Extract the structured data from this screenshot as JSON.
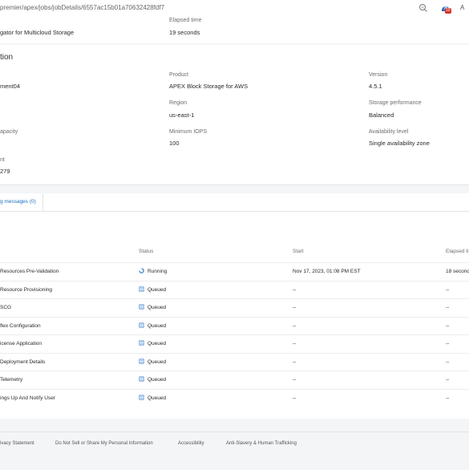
{
  "browser": {
    "url": "premier/apex/jobs/jobDetails/6557ac15b01a70632428fdf7",
    "extension_badge": "10",
    "profile_initial": "A"
  },
  "summary": {
    "name_value": "gator for Multicloud Storage",
    "elapsed_label": "Elapsed time",
    "elapsed_value": "19 seconds"
  },
  "details": {
    "heading": "tion",
    "fields": {
      "deployment_value": "ment04",
      "product_label": "Product",
      "product_value": "APEX Block Storage for AWS",
      "version_label": "Version",
      "version_value": "4.5.1",
      "region_label": "Region",
      "region_value": "us-east-1",
      "perf_label": "Storage performance",
      "perf_value": "Balanced",
      "capacity_label": "apacity",
      "iops_label": "Minimum IOPS",
      "iops_value": "100",
      "avail_label": "Availability level",
      "avail_value": "Single availability zone",
      "account_label": "nt",
      "account_value": "279"
    }
  },
  "tabs": {
    "messages": "g messages (0)"
  },
  "table": {
    "headers": {
      "status": "Status",
      "start": "Start",
      "elapsed": "Elapsed ti"
    },
    "rows": [
      {
        "task": "Resources Pre-Validation",
        "status": "Running",
        "start": "Nov 17, 2023, 01:08 PM EST",
        "elapsed": "18 second"
      },
      {
        "task": "Resource Provisioning",
        "status": "Queued",
        "start": "--",
        "elapsed": "--"
      },
      {
        "task": "SCG",
        "status": "Queued",
        "start": "--",
        "elapsed": "--"
      },
      {
        "task": "flex Configuration",
        "status": "Queued",
        "start": "--",
        "elapsed": "--"
      },
      {
        "task": "icense Application",
        "status": "Queued",
        "start": "--",
        "elapsed": "--"
      },
      {
        "task": "Deployment Details",
        "status": "Queued",
        "start": "--",
        "elapsed": "--"
      },
      {
        "task": "Telemetry",
        "status": "Queued",
        "start": "--",
        "elapsed": "--"
      },
      {
        "task": "ings Up And Notify User",
        "status": "Queued",
        "start": "--",
        "elapsed": "--"
      }
    ]
  },
  "footer": {
    "privacy": "ivacy Statement",
    "do_not_sell": "Do Not Sell or Share My Personal Information",
    "accessibility": "Accessibility",
    "anti_slavery": "Anti-Slavery & Human Trafficking"
  },
  "colors": {
    "link": "#1a6fc0",
    "running": "#1a6fc0",
    "queued": "#3b7fd1"
  }
}
